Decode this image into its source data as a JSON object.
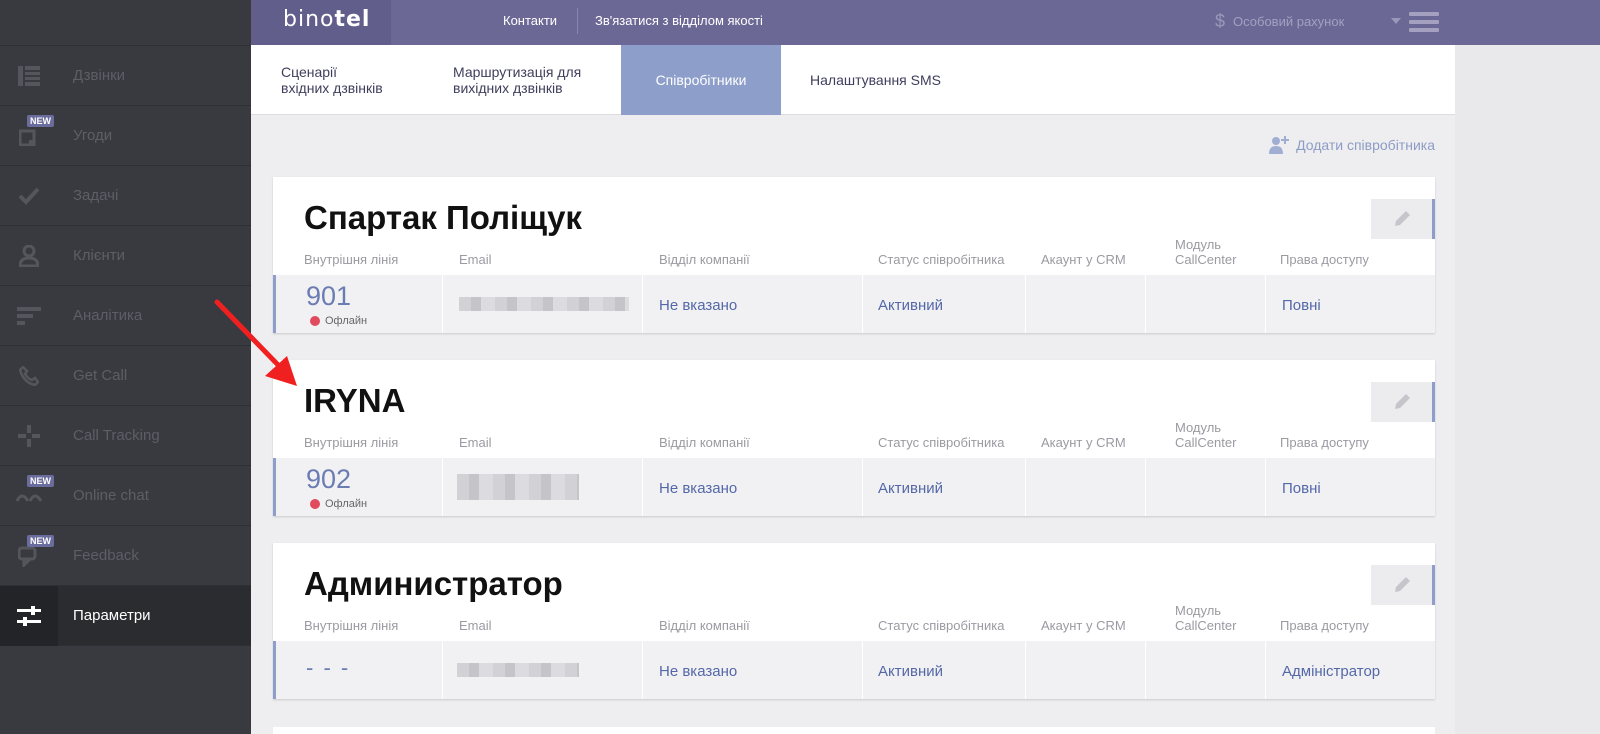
{
  "sidebar": {
    "items": [
      {
        "label": "Дзвінки",
        "icon": "calls-table-icon",
        "new": false
      },
      {
        "label": "Угоди",
        "icon": "deals-icon",
        "new": true
      },
      {
        "label": "Задачі",
        "icon": "check-icon",
        "new": false
      },
      {
        "label": "Клієнти",
        "icon": "person-icon",
        "new": false
      },
      {
        "label": "Аналітика",
        "icon": "analytics-icon",
        "new": false
      },
      {
        "label": "Get Call",
        "icon": "phone-icon",
        "new": false
      },
      {
        "label": "Call Tracking",
        "icon": "crosshair-icon",
        "new": false
      },
      {
        "label": "Online chat",
        "icon": "chat-icon",
        "new": true
      },
      {
        "label": "Feedback",
        "icon": "feedback-icon",
        "new": true
      },
      {
        "label": "Параметри",
        "icon": "sliders-icon",
        "new": false,
        "active": true
      }
    ],
    "new_badge": "NEW"
  },
  "topbar": {
    "logo_light": "bino",
    "logo_bold": "tel",
    "links": [
      "Контакти",
      "Зв'язатися з відділом якості"
    ],
    "account_label": "Особовий рахунок"
  },
  "tabs": [
    {
      "line1": "Сценарії",
      "line2": "вхідних дзвінків"
    },
    {
      "line1": "Маршрутизація для",
      "line2": "вихідних дзвінків"
    },
    {
      "line1": "Співробітники",
      "line2": ""
    },
    {
      "line1": "Налаштування SMS",
      "line2": ""
    }
  ],
  "add_employee": "Додати співробітника",
  "columns": {
    "ext": "Внутрішня лінія",
    "email": "Email",
    "dept": "Відділ компанії",
    "status": "Статус співробітника",
    "crm": "Акаунт у CRM",
    "callcenter_1": "Модуль",
    "callcenter_2": "CallCenter",
    "access": "Права доступу"
  },
  "employees": [
    {
      "name": "Спартак Поліщук",
      "ext": "901",
      "presence": "Офлайн",
      "dept": "Не вказано",
      "status": "Активний",
      "access": "Повні"
    },
    {
      "name": "IRYNA",
      "ext": "902",
      "presence": "Офлайн",
      "dept": "Не вказано",
      "status": "Активний",
      "access": "Повні"
    },
    {
      "name": "Администратор",
      "ext": "- - -",
      "presence": "",
      "dept": "Не вказано",
      "status": "Активний",
      "access": "Адміністратор"
    }
  ],
  "colors": {
    "topbar": "#6c6896",
    "sidebar": "#393a40",
    "accent": "#8c9ec9",
    "link": "#5468a8",
    "offline_dot": "#e24a5e",
    "annotation_arrow": "#f02020"
  }
}
